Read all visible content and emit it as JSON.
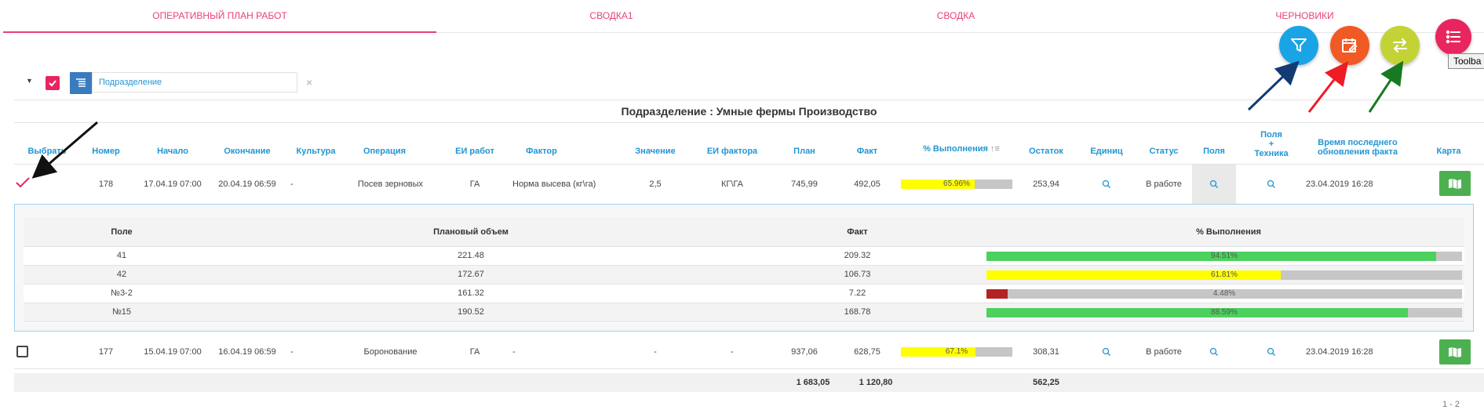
{
  "tabs": [
    {
      "label": "ОПЕРАТИВНЫЙ ПЛАН РАБОТ",
      "active": true
    },
    {
      "label": "СВОДКА1"
    },
    {
      "label": "СВОДКА"
    },
    {
      "label": "ЧЕРНОВИКИ"
    }
  ],
  "toolbar": {
    "tooltip": "Toolba",
    "fab_icons": [
      "filter-icon",
      "calendar-edit-icon",
      "swap-arrows-icon",
      "list-icon"
    ],
    "fab_colors": [
      "#1aa4e6",
      "#f15a24",
      "#c3d336",
      "#e8255f"
    ]
  },
  "grouping": {
    "chip_label": "Подразделение",
    "remove": "×",
    "caret": "▼"
  },
  "group_header": "Подразделение : Умные фермы Производство",
  "columns": {
    "select": "Выбрать",
    "number": "Номер",
    "start": "Начало",
    "end": "Окончание",
    "culture": "Культура",
    "operation": "Операция",
    "unit_work": "ЕИ работ",
    "factor": "Фактор",
    "value": "Значение",
    "unit_factor": "ЕИ фактора",
    "plan": "План",
    "fact": "Факт",
    "percent": "% Выполнения",
    "remainder": "Остаток",
    "units": "Единиц",
    "status": "Статус",
    "fields": "Поля",
    "fields_tech_1": "Поля",
    "fields_tech_2": "+",
    "fields_tech_3": "Техника",
    "last_update_1": "Время последнего",
    "last_update_2": "обновления факта",
    "map": "Карта"
  },
  "rows": [
    {
      "selected": true,
      "number": "178",
      "start": "17.04.19 07:00",
      "end": "20.04.19 06:59",
      "culture": "-",
      "operation": "Посев зерновых",
      "unit_work": "ГА",
      "factor": "Норма высева (кг\\га)",
      "value": "2,5",
      "unit_factor": "КГ\\ГА",
      "plan": "745,99",
      "fact": "492,05",
      "percent_text": "65.96%",
      "percent_value": 65.96,
      "remainder": "253,94",
      "status": "В работе",
      "last_update": "23.04.2019 16:28"
    },
    {
      "selected": false,
      "number": "177",
      "start": "15.04.19 07:00",
      "end": "16.04.19 06:59",
      "culture": "-",
      "operation": "Боронование",
      "unit_work": "ГА",
      "factor": "-",
      "value": "-",
      "unit_factor": "-",
      "plan": "937,06",
      "fact": "628,75",
      "percent_text": "67.1%",
      "percent_value": 67.1,
      "remainder": "308,31",
      "status": "В работе",
      "last_update": "23.04.2019 16:28"
    }
  ],
  "detail": {
    "headers": {
      "field": "Поле",
      "plan_volume": "Плановый объем",
      "fact": "Факт",
      "percent": "% Выполнения"
    },
    "rows": [
      {
        "field": "41",
        "plan_volume": "221.48",
        "fact": "209.32",
        "percent_text": "94.51%",
        "percent_value": 94.51,
        "color": "#4cd05e"
      },
      {
        "field": "42",
        "plan_volume": "172.67",
        "fact": "106.73",
        "percent_text": "61.81%",
        "percent_value": 61.81,
        "color": "#ffff00"
      },
      {
        "field": "№3-2",
        "plan_volume": "161.32",
        "fact": "7.22",
        "percent_text": "4.48%",
        "percent_value": 4.48,
        "color": "#b32323"
      },
      {
        "field": "№15",
        "plan_volume": "190.52",
        "fact": "168.78",
        "percent_text": "88.59%",
        "percent_value": 88.59,
        "color": "#4cd05e"
      }
    ]
  },
  "totals": {
    "plan": "1 683,05",
    "fact": "1 120,80",
    "remainder": "562,25"
  },
  "pager": "1 - 2",
  "colors": {
    "accent": "#e8417a",
    "link": "#2196d3",
    "progress_main": "#ffff00",
    "progress_track": "#c6c6c6",
    "map_button": "#4cb050"
  }
}
